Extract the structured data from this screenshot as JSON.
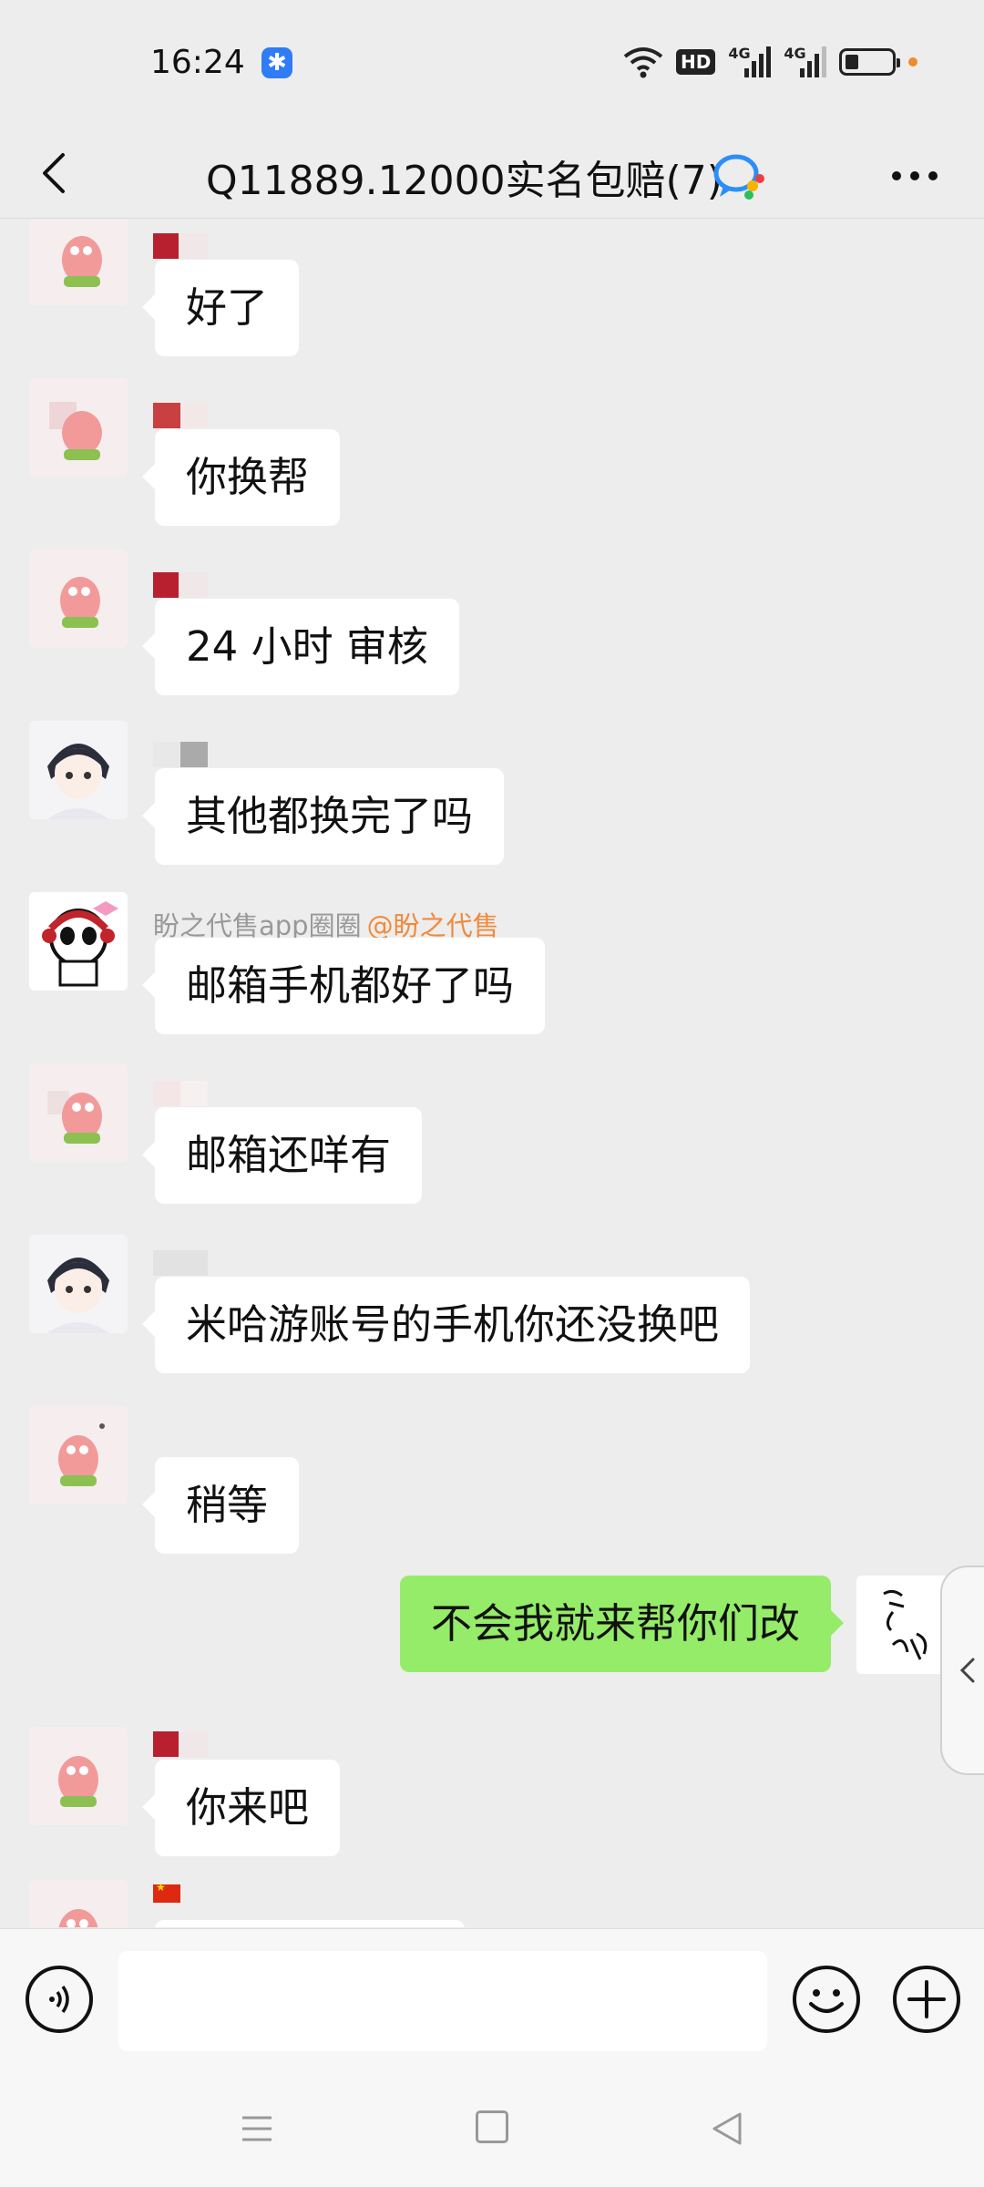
{
  "status_bar": {
    "time": "16:24",
    "network": "4G",
    "hd": "HD"
  },
  "header": {
    "title": "Q11889.12000实名包赔(7)"
  },
  "messages": [
    {
      "text": "好了"
    },
    {
      "text": "你换帮"
    },
    {
      "text": "24 小时 审核"
    },
    {
      "text": "其他都换完了吗"
    },
    {
      "sender": "盼之代售app圈圈",
      "mention": "@盼之代售",
      "text": "邮箱手机都好了吗"
    },
    {
      "text": "邮箱还咩有"
    },
    {
      "text": "米哈游账号的手机你还没换吧"
    },
    {
      "text": "稍等"
    },
    {
      "text": "不会我就来帮你们改",
      "mine": true
    },
    {
      "text": "你来吧"
    }
  ],
  "input": {
    "placeholder": ""
  },
  "colors": {
    "background": "#ededed",
    "my_bubble": "#95ec69",
    "mention": "#f08a3c"
  }
}
